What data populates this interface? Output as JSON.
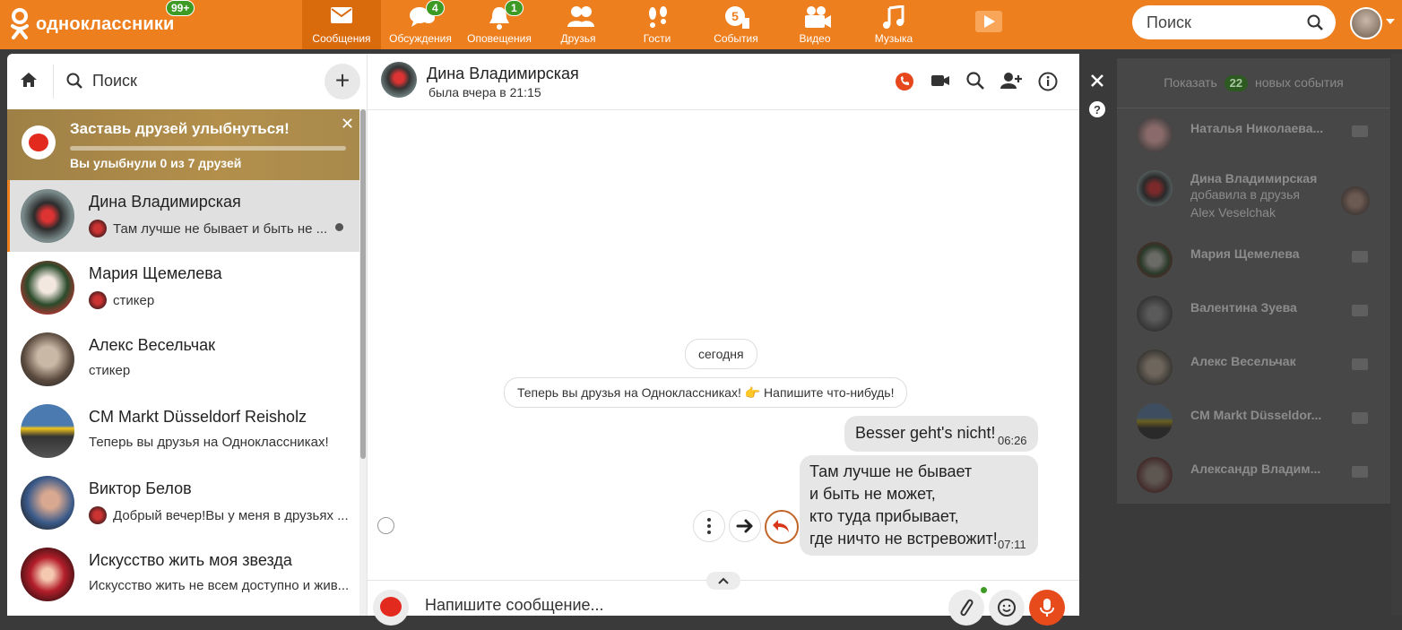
{
  "topbar": {
    "logo_text": "одноклассники",
    "logo_badge": "99+",
    "nav": [
      {
        "label": "Сообщения",
        "icon": "envelope-icon",
        "badge": ""
      },
      {
        "label": "Обсуждения",
        "icon": "chat-bubbles-icon",
        "badge": "4"
      },
      {
        "label": "Оповещения",
        "icon": "bell-icon",
        "badge": "1"
      },
      {
        "label": "Друзья",
        "icon": "friends-icon",
        "badge": ""
      },
      {
        "label": "Гости",
        "icon": "footprints-icon",
        "badge": ""
      },
      {
        "label": "События",
        "icon": "events-icon",
        "badge": ""
      },
      {
        "label": "Видео",
        "icon": "video-camera-icon",
        "badge": ""
      },
      {
        "label": "Музыка",
        "icon": "music-note-icon",
        "badge": ""
      }
    ],
    "search_label": "Поиск"
  },
  "sidebar": {
    "search_label": "Поиск",
    "add_label": "+",
    "promo": {
      "title": "Заставь друзей улыбнуться!",
      "subtitle": "Вы улыбнули 0 из 7 друзей",
      "close": "✕"
    },
    "chats": [
      {
        "name": "Дина Владимирская",
        "preview": "Там лучше не бывает и быть не ...",
        "has_mini_avatar": true,
        "unread": true
      },
      {
        "name": "Мария Щемелева",
        "preview": "стикер",
        "has_mini_avatar": true,
        "unread": false
      },
      {
        "name": "Алекс Весельчак",
        "preview": "стикер",
        "has_mini_avatar": false,
        "unread": false
      },
      {
        "name": "CM Markt Düsseldorf Reisholz",
        "preview": "Теперь вы друзья на Одноклассниках!",
        "has_mini_avatar": false,
        "unread": false
      },
      {
        "name": "Виктор Белов",
        "preview": "Добрый вечер!Вы у меня в друзьях ...",
        "has_mini_avatar": true,
        "unread": false
      },
      {
        "name": "Искусство жить моя звезда",
        "preview": "Искусство жить не всем доступно и жив...",
        "has_mini_avatar": false,
        "unread": false
      }
    ]
  },
  "chat": {
    "contact_name": "Дина Владимирская",
    "contact_status": "была вчера в 21:15",
    "date_divider": "сегодня",
    "system_message": "Теперь вы друзья на Одноклассниках! 👉 Напишите что-нибудь!",
    "messages": [
      {
        "text": "Besser geht's nicht!",
        "time": "06:26"
      },
      {
        "lines": [
          "Там лучше не бывает",
          "и быть не может,",
          "кто туда прибывает,",
          "где ничто не встревожит!"
        ],
        "time": "07:11"
      }
    ],
    "composer_placeholder": "Напишите сообщение..."
  },
  "events": {
    "show_prefix": "Показать",
    "show_count": "22",
    "show_suffix": "новых события",
    "items": [
      {
        "name": "Наталья Николаева...",
        "sub": []
      },
      {
        "name": "Дина Владимирская",
        "sub": [
          "добавила в друзья",
          "Alex Veselchak"
        ]
      },
      {
        "name": "Мария Щемелева",
        "sub": []
      },
      {
        "name": "Валентина Зуева",
        "sub": []
      },
      {
        "name": "Алекс Весельчак",
        "sub": []
      },
      {
        "name": "CM Markt Düsseldor...",
        "sub": []
      },
      {
        "name": "Александр Владим...",
        "sub": []
      }
    ]
  },
  "colors": {
    "brand_orange": "#ee7f1f",
    "badge_green": "#3d9a25",
    "mic_red": "#e74b1c"
  }
}
